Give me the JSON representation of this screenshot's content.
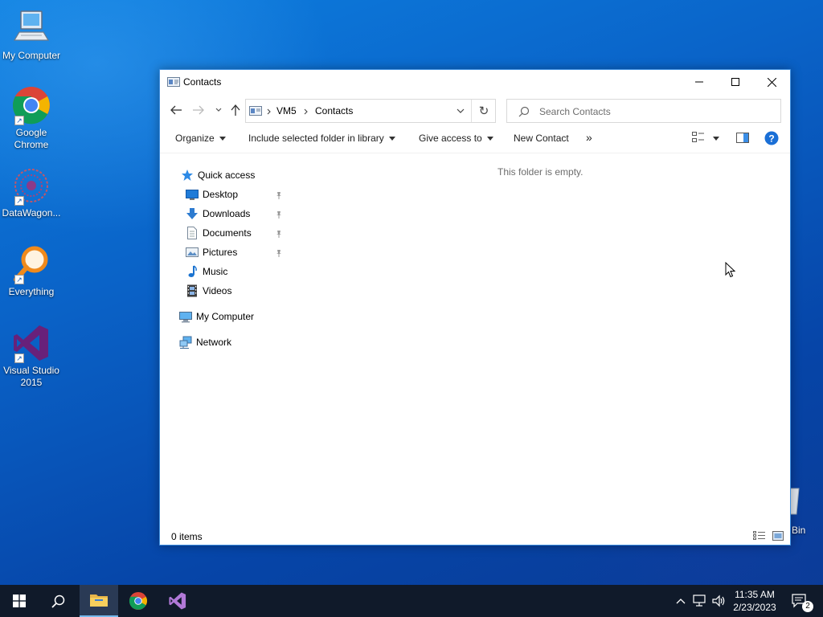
{
  "desktop": {
    "icons": [
      {
        "label": "My Computer"
      },
      {
        "label": "Google Chrome"
      },
      {
        "label": "DataWagon..."
      },
      {
        "label": "Everything"
      },
      {
        "label": "Visual Studio 2015"
      }
    ],
    "recycle_bin_label": "Bin"
  },
  "window": {
    "title": "Contacts",
    "breadcrumbs": [
      "VM5",
      "Contacts"
    ],
    "search_placeholder": "Search Contacts",
    "toolbar": {
      "organize": "Organize",
      "include_in_library": "Include selected folder in library",
      "give_access": "Give access to",
      "new_contact": "New Contact",
      "more": "»"
    },
    "nav": {
      "quick_access": "Quick access",
      "pinned": [
        {
          "label": "Desktop"
        },
        {
          "label": "Downloads"
        },
        {
          "label": "Documents"
        },
        {
          "label": "Pictures"
        }
      ],
      "unpinned": [
        {
          "label": "Music"
        },
        {
          "label": "Videos"
        }
      ],
      "my_computer": "My Computer",
      "network": "Network"
    },
    "empty_message": "This folder is empty.",
    "status": "0 items"
  },
  "taskbar": {
    "time": "11:35 AM",
    "date": "2/23/2023",
    "notification_count": "2"
  },
  "colors": {
    "accent": "#0078d7",
    "taskbar_bg": "#101a2a",
    "window_border": "#3d8ee0"
  }
}
